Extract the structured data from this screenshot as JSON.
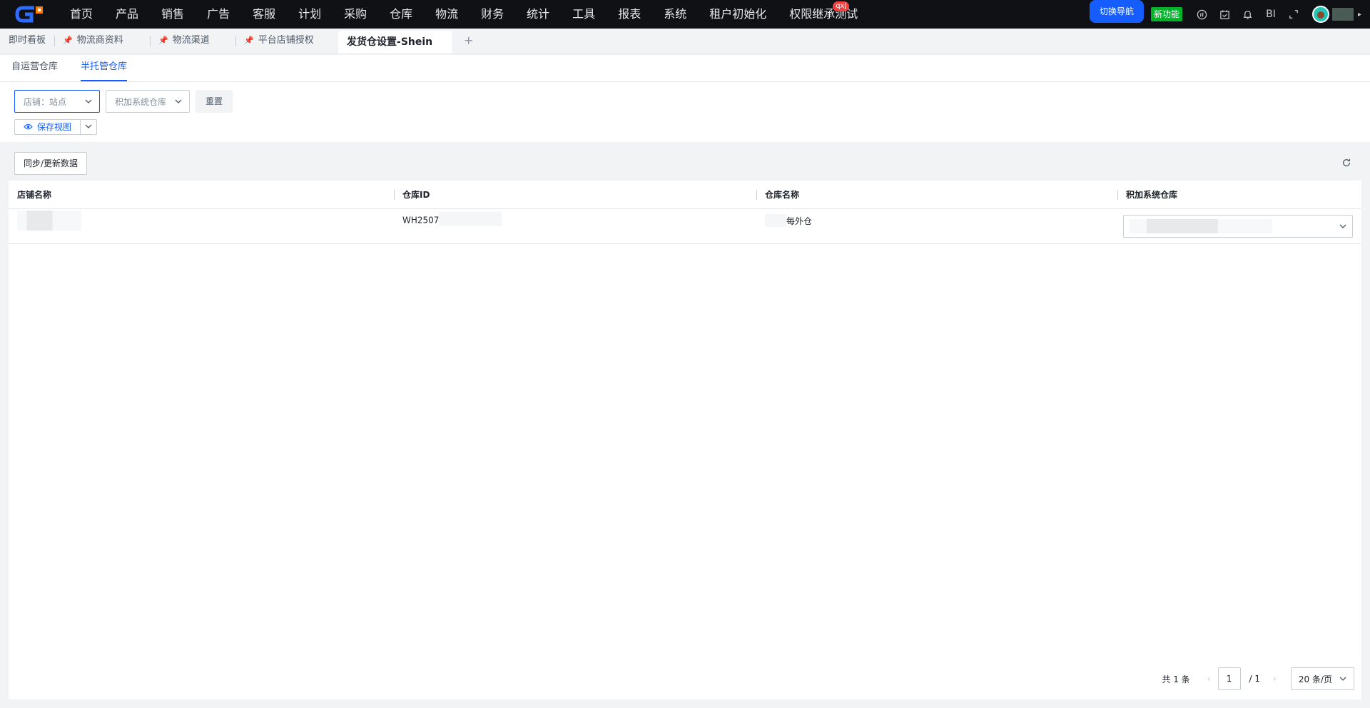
{
  "nav": {
    "menu": [
      "首页",
      "产品",
      "销售",
      "广告",
      "客服",
      "计划",
      "采购",
      "仓库",
      "物流",
      "财务",
      "统计",
      "工具",
      "报表",
      "系统",
      "租户初始化",
      "权限继承测试"
    ],
    "badge": "qxj",
    "switch_nav": "切换导航",
    "new_feature": "新功能",
    "bi": "BI",
    "colors": {
      "bar": "#0f1114",
      "accent": "#165dff",
      "new": "#00b42a",
      "badge": "#f53f3f"
    }
  },
  "page_tabs": [
    {
      "label": "即时看板",
      "pinned": false
    },
    {
      "label": "物流商资料",
      "pinned": true
    },
    {
      "label": "物流渠道",
      "pinned": true
    },
    {
      "label": "平台店铺授权",
      "pinned": true
    },
    {
      "label": "发货仓设置-Shein",
      "pinned": false,
      "active": true
    }
  ],
  "tab_add": "+",
  "sub_tabs": [
    "自运营仓库",
    "半托管仓库"
  ],
  "filters": {
    "store_placeholder": "店铺：站点",
    "warehouse_placeholder": "积加系统仓库",
    "reset": "重置",
    "save_view": "保存视图"
  },
  "toolbar": {
    "sync": "同步/更新数据"
  },
  "table": {
    "columns": [
      "店铺名称",
      "仓库ID",
      "仓库名称",
      "积加系统仓库"
    ],
    "rows": [
      {
        "store": "",
        "warehouse_id": "WH2507",
        "warehouse_name": "每外仓",
        "system_warehouse": ""
      }
    ]
  },
  "pager": {
    "total": "共 1 条",
    "page": "1",
    "of": "/ 1",
    "size": "20 条/页"
  }
}
